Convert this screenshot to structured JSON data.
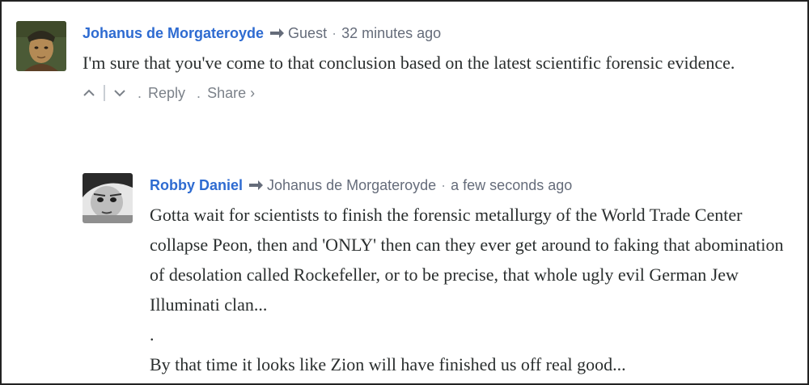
{
  "comments": [
    {
      "author": "Johanus de Morgateroyde",
      "reply_to": "Guest",
      "separator": "·",
      "time": "32 minutes ago",
      "text": "I'm sure that you've come to that conclusion based on the latest scientific forensic evidence.",
      "actions": {
        "dot": ".",
        "reply": "Reply",
        "share": "Share ›"
      }
    },
    {
      "author": "Robby Daniel",
      "reply_to": "Johanus de Morgateroyde",
      "separator": "·",
      "time": "a few seconds ago",
      "text": "Gotta wait for scientists to finish the forensic metallurgy of the World Trade Center collapse Peon, then and 'ONLY' then can they ever get around to faking that abomination of desolation called Rockefeller, or to be precise, that whole ugly evil German Jew Illuminati clan...\n.\nBy that time it looks like Zion will have finished us off real good..."
    }
  ],
  "icons": {
    "reply_arrow": "reply-arrow-icon",
    "upvote": "chevron-up-icon",
    "downvote": "chevron-down-icon"
  },
  "colors": {
    "author": "#2e6bd1",
    "meta": "#656c7a",
    "body_text": "#2a2e2e",
    "actions": "#7b8189"
  }
}
